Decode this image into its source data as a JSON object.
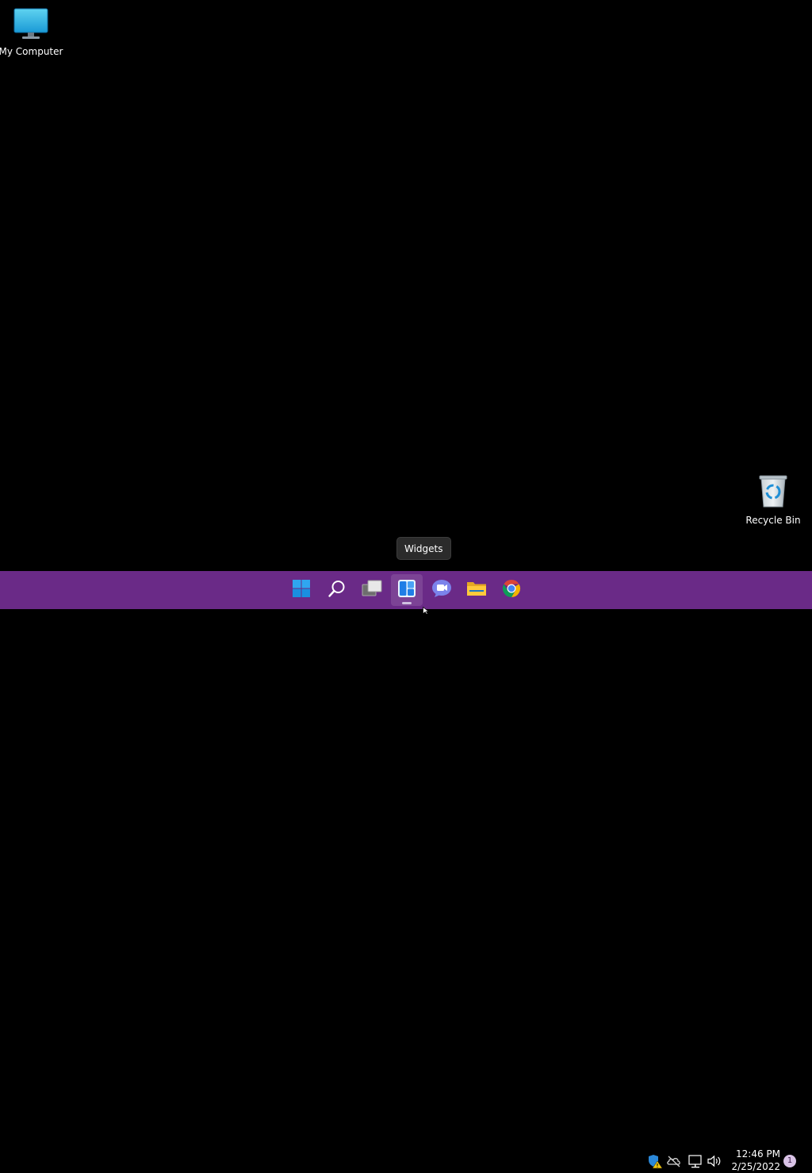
{
  "desktop": {
    "background": "#000000",
    "icons": [
      {
        "label": "My Computer",
        "icon": "monitor-icon"
      },
      {
        "label": "Recycle Bin",
        "icon": "recycle-bin-icon"
      }
    ]
  },
  "tooltip": {
    "text": "Widgets"
  },
  "taskbar": {
    "background": "#6a2a87",
    "pinned": [
      {
        "name": "Start",
        "icon": "windows-start-icon"
      },
      {
        "name": "Search",
        "icon": "search-icon"
      },
      {
        "name": "Task View",
        "icon": "task-view-icon"
      },
      {
        "name": "Widgets",
        "icon": "widgets-icon",
        "active": true
      },
      {
        "name": "Chat",
        "icon": "chat-icon"
      },
      {
        "name": "File Explorer",
        "icon": "folder-icon"
      },
      {
        "name": "Google Chrome",
        "icon": "chrome-icon"
      }
    ],
    "tray": {
      "icons": [
        "defender-warning-icon",
        "onedrive-offline-icon",
        "network-icon",
        "volume-icon"
      ],
      "time": "12:46 PM",
      "date": "2/25/2022",
      "notifications": "1"
    }
  }
}
